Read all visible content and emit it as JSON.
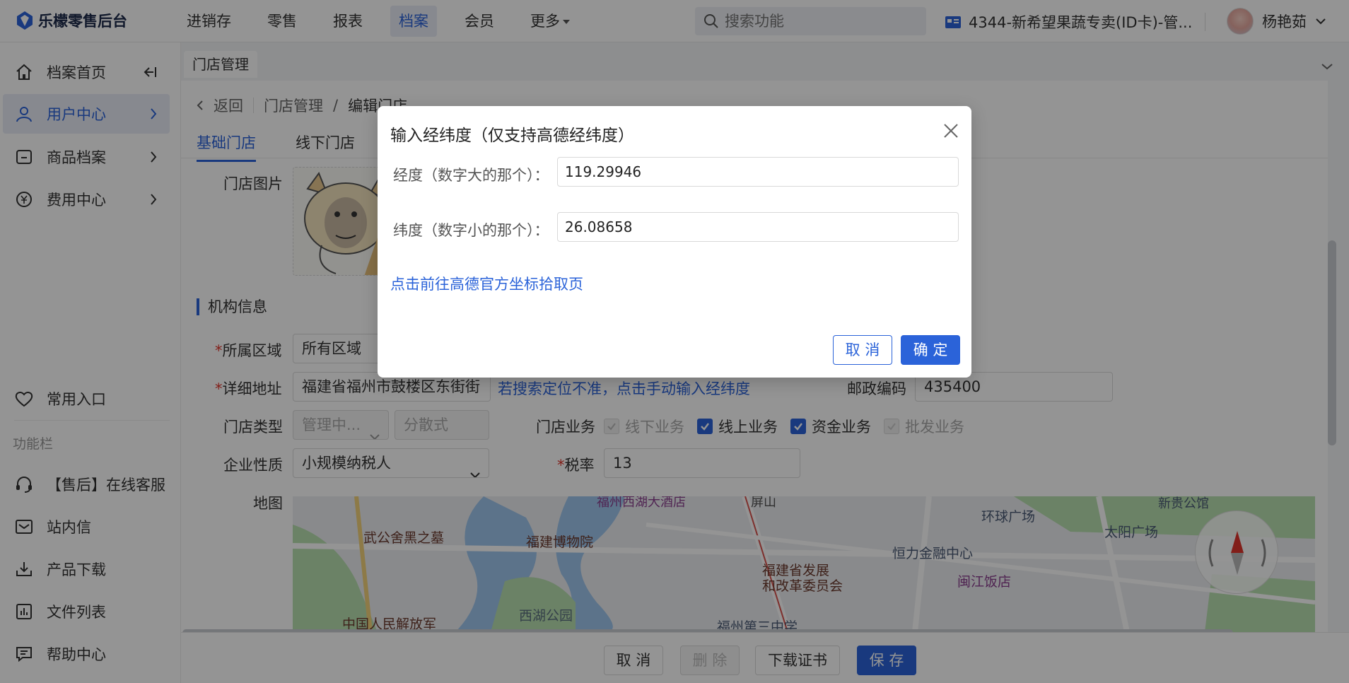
{
  "app": {
    "logo_text": "乐檬零售后台"
  },
  "topnav": [
    {
      "label": "进销存",
      "active": false
    },
    {
      "label": "零售",
      "active": false
    },
    {
      "label": "报表",
      "active": false
    },
    {
      "label": "档案",
      "active": true
    },
    {
      "label": "会员",
      "active": false
    },
    {
      "label": "更多",
      "active": false
    }
  ],
  "search": {
    "placeholder": "搜索功能"
  },
  "store": {
    "name": "4344-新希望果蔬专卖(ID卡)-管..."
  },
  "user": {
    "name": "杨艳茹"
  },
  "sidebar": {
    "items": [
      {
        "label": "档案首页"
      },
      {
        "label": "用户中心"
      },
      {
        "label": "商品档案"
      },
      {
        "label": "费用中心"
      }
    ],
    "common_entry": "常用入口",
    "group_label": "功能栏",
    "tools": [
      {
        "label": "【售后】在线客服"
      },
      {
        "label": "站内信"
      },
      {
        "label": "产品下载"
      },
      {
        "label": "文件列表"
      },
      {
        "label": "帮助中心"
      }
    ]
  },
  "page_tab": "门店管理",
  "breadcrumb": {
    "back": "返回",
    "parent": "门店管理",
    "sep": "/",
    "current": "编辑门店"
  },
  "subtabs": [
    {
      "label": "基础门店"
    },
    {
      "label": "线下门店"
    }
  ],
  "form": {
    "photo_label": "门店图片",
    "section_title": "机构信息",
    "region_label": "所属区域",
    "region_value": "所有区域",
    "address_label": "详细地址",
    "address_value": "福建省福州市鼓楼区东街街",
    "manual_link": "若搜索定位不准，点击手动输入经纬度",
    "postcode_label": "邮政编码",
    "postcode_value": "435400",
    "store_type_label": "门店类型",
    "store_type_value": "管理中...",
    "store_type2_value": "分散式",
    "business_label": "门店业务",
    "biz": [
      {
        "label": "线下业务",
        "checked": true,
        "disabled": true
      },
      {
        "label": "线上业务",
        "checked": true,
        "disabled": false
      },
      {
        "label": "资金业务",
        "checked": true,
        "disabled": false
      },
      {
        "label": "批发业务",
        "checked": false,
        "disabled": true
      }
    ],
    "nature_label": "企业性质",
    "nature_value": "小规模纳税人",
    "tax_label": "税率",
    "tax_value": "13",
    "map_label": "地图",
    "required_mark": "*"
  },
  "map_labels": {
    "l1": "福州西湖大酒店",
    "l2": "屏山",
    "l3": "环球广场",
    "l4": "新贵公馆",
    "l5": "武公舍黑之墓",
    "l6": "福建博物院",
    "l7": "太阳广场",
    "l8": "恒力金融中心",
    "l9": "福建省发展",
    "l10": "和改革委员会",
    "l11": "闽江饭店",
    "l12": "西湖公园",
    "l13": "中国人民解放军",
    "l14": "福州第三中学"
  },
  "bottom": {
    "cancel": "取 消",
    "delete": "删 除",
    "download": "下载证书",
    "save": "保 存"
  },
  "modal": {
    "title": "输入经纬度（仅支持高德经纬度）",
    "lng_label": "经度（数字大的那个）：",
    "lng_value": "119.29946",
    "lat_label": "纬度（数字小的那个）：",
    "lat_value": "26.08658",
    "link": "点击前往高德官方坐标拾取页",
    "cancel": "取 消",
    "ok": "确 定"
  },
  "colors": {
    "primary": "#2b63d9",
    "required": "#e0352b",
    "mask": "rgba(0,0,0,0.42)"
  }
}
